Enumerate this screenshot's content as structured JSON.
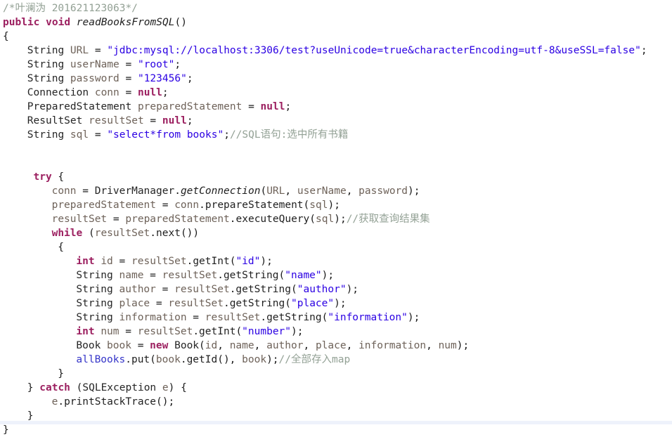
{
  "editor": {
    "language": "java",
    "background_color": "#ffffff",
    "font_size_px": 14.5,
    "line_height_px": 20,
    "theme_colors": {
      "keyword": "#9c2060",
      "string": "#2b00e3",
      "comment": "#93a195",
      "type": "#252525",
      "local_variable": "#6e6259",
      "field": "#3434c8",
      "method": "#1f1f1f",
      "punctuation": "#1a1a1a",
      "bottom_band": "#eef2fb"
    }
  },
  "code": {
    "header_comment": "/*叶澜沩 201621123063*/",
    "method_signature": {
      "modifier": "public",
      "return_type": "void",
      "name": "readBooksFromSQL()"
    },
    "literals": {
      "jdbc_url": "\"jdbc:mysql://localhost:3306/test?useUnicode=true&characterEncoding=utf-8&useSSL=false\"",
      "user_name": "\"root\"",
      "password": "\"123456\"",
      "sql": "\"select*from books\"",
      "col_id": "\"id\"",
      "col_name": "\"name\"",
      "col_author": "\"author\"",
      "col_place": "\"place\"",
      "col_information": "\"information\"",
      "col_number": "\"number\""
    },
    "comments": {
      "sql_statement": "//SQL语句:选中所有书籍",
      "result_set": "//获取查询结果集",
      "store_map": "//全部存入map"
    },
    "lines": [
      {
        "n": 1,
        "indent": 0,
        "tokens": [
          {
            "c": "t-cmt",
            "t": "/*叶澜沩 201621123063*/"
          }
        ]
      },
      {
        "n": 2,
        "indent": 0,
        "tokens": [
          {
            "c": "t-kw",
            "t": "public"
          },
          {
            "c": "t-plain",
            "t": " "
          },
          {
            "c": "t-kw",
            "t": "void"
          },
          {
            "c": "t-plain",
            "t": " "
          },
          {
            "c": "t-methodi",
            "t": "readBooksFromSQL"
          },
          {
            "c": "t-punct",
            "t": "()"
          }
        ]
      },
      {
        "n": 3,
        "indent": 0,
        "tokens": [
          {
            "c": "t-punct",
            "t": "{"
          }
        ]
      },
      {
        "n": 4,
        "indent": 4,
        "tokens": [
          {
            "c": "t-type",
            "t": "String"
          },
          {
            "c": "t-plain",
            "t": " "
          },
          {
            "c": "t-var",
            "t": "URL"
          },
          {
            "c": "t-plain",
            "t": " = "
          },
          {
            "c": "t-str",
            "t": "\"jdbc:mysql://localhost:3306/test?useUnicode=true&characterEncoding=utf-8&useSSL=false\""
          },
          {
            "c": "t-punct",
            "t": ";"
          }
        ]
      },
      {
        "n": 5,
        "indent": 4,
        "tokens": [
          {
            "c": "t-type",
            "t": "String"
          },
          {
            "c": "t-plain",
            "t": " "
          },
          {
            "c": "t-var",
            "t": "userName"
          },
          {
            "c": "t-plain",
            "t": " = "
          },
          {
            "c": "t-str",
            "t": "\"root\""
          },
          {
            "c": "t-punct",
            "t": ";"
          }
        ]
      },
      {
        "n": 6,
        "indent": 4,
        "tokens": [
          {
            "c": "t-type",
            "t": "String"
          },
          {
            "c": "t-plain",
            "t": " "
          },
          {
            "c": "t-var",
            "t": "password"
          },
          {
            "c": "t-plain",
            "t": " = "
          },
          {
            "c": "t-str",
            "t": "\"123456\""
          },
          {
            "c": "t-punct",
            "t": ";"
          }
        ]
      },
      {
        "n": 7,
        "indent": 4,
        "tokens": [
          {
            "c": "t-type",
            "t": "Connection"
          },
          {
            "c": "t-plain",
            "t": " "
          },
          {
            "c": "t-var",
            "t": "conn"
          },
          {
            "c": "t-plain",
            "t": " = "
          },
          {
            "c": "t-kw",
            "t": "null"
          },
          {
            "c": "t-punct",
            "t": ";"
          }
        ]
      },
      {
        "n": 8,
        "indent": 4,
        "tokens": [
          {
            "c": "t-type",
            "t": "PreparedStatement"
          },
          {
            "c": "t-plain",
            "t": " "
          },
          {
            "c": "t-var",
            "t": "preparedStatement"
          },
          {
            "c": "t-plain",
            "t": " = "
          },
          {
            "c": "t-kw",
            "t": "null"
          },
          {
            "c": "t-punct",
            "t": ";"
          }
        ]
      },
      {
        "n": 9,
        "indent": 4,
        "tokens": [
          {
            "c": "t-type",
            "t": "ResultSet"
          },
          {
            "c": "t-plain",
            "t": " "
          },
          {
            "c": "t-var",
            "t": "resultSet"
          },
          {
            "c": "t-plain",
            "t": " = "
          },
          {
            "c": "t-kw",
            "t": "null"
          },
          {
            "c": "t-punct",
            "t": ";"
          }
        ]
      },
      {
        "n": 10,
        "indent": 4,
        "tokens": [
          {
            "c": "t-type",
            "t": "String"
          },
          {
            "c": "t-plain",
            "t": " "
          },
          {
            "c": "t-var",
            "t": "sql"
          },
          {
            "c": "t-plain",
            "t": " = "
          },
          {
            "c": "t-str",
            "t": "\"select*from books\""
          },
          {
            "c": "t-punct",
            "t": ";"
          },
          {
            "c": "t-cmt",
            "t": "//SQL语句:选中所有书籍"
          }
        ]
      },
      {
        "n": 11,
        "indent": 0,
        "tokens": []
      },
      {
        "n": 12,
        "indent": 0,
        "tokens": []
      },
      {
        "n": 13,
        "indent": 5,
        "tokens": [
          {
            "c": "t-kw",
            "t": "try"
          },
          {
            "c": "t-punct",
            "t": " {"
          }
        ]
      },
      {
        "n": 14,
        "indent": 8,
        "tokens": [
          {
            "c": "t-var",
            "t": "conn"
          },
          {
            "c": "t-plain",
            "t": " = "
          },
          {
            "c": "t-type",
            "t": "DriverManager"
          },
          {
            "c": "t-punct",
            "t": "."
          },
          {
            "c": "t-methodi",
            "t": "getConnection"
          },
          {
            "c": "t-punct",
            "t": "("
          },
          {
            "c": "t-var",
            "t": "URL"
          },
          {
            "c": "t-punct",
            "t": ", "
          },
          {
            "c": "t-var",
            "t": "userName"
          },
          {
            "c": "t-punct",
            "t": ", "
          },
          {
            "c": "t-var",
            "t": "password"
          },
          {
            "c": "t-punct",
            "t": ");"
          }
        ]
      },
      {
        "n": 15,
        "indent": 8,
        "tokens": [
          {
            "c": "t-var",
            "t": "preparedStatement"
          },
          {
            "c": "t-plain",
            "t": " = "
          },
          {
            "c": "t-var",
            "t": "conn"
          },
          {
            "c": "t-punct",
            "t": "."
          },
          {
            "c": "t-method",
            "t": "prepareStatement"
          },
          {
            "c": "t-punct",
            "t": "("
          },
          {
            "c": "t-var",
            "t": "sql"
          },
          {
            "c": "t-punct",
            "t": ");"
          }
        ]
      },
      {
        "n": 16,
        "indent": 8,
        "tokens": [
          {
            "c": "t-var",
            "t": "resultSet"
          },
          {
            "c": "t-plain",
            "t": " = "
          },
          {
            "c": "t-var",
            "t": "preparedStatement"
          },
          {
            "c": "t-punct",
            "t": "."
          },
          {
            "c": "t-method",
            "t": "executeQuery"
          },
          {
            "c": "t-punct",
            "t": "("
          },
          {
            "c": "t-var",
            "t": "sql"
          },
          {
            "c": "t-punct",
            "t": ");"
          },
          {
            "c": "t-cmt",
            "t": "//获取查询结果集"
          }
        ]
      },
      {
        "n": 17,
        "indent": 8,
        "tokens": [
          {
            "c": "t-kw",
            "t": "while"
          },
          {
            "c": "t-punct",
            "t": " ("
          },
          {
            "c": "t-var",
            "t": "resultSet"
          },
          {
            "c": "t-punct",
            "t": "."
          },
          {
            "c": "t-method",
            "t": "next"
          },
          {
            "c": "t-punct",
            "t": "())"
          }
        ]
      },
      {
        "n": 18,
        "indent": 9,
        "tokens": [
          {
            "c": "t-punct",
            "t": "{"
          }
        ]
      },
      {
        "n": 19,
        "indent": 12,
        "tokens": [
          {
            "c": "t-kw",
            "t": "int"
          },
          {
            "c": "t-plain",
            "t": " "
          },
          {
            "c": "t-var",
            "t": "id"
          },
          {
            "c": "t-plain",
            "t": " = "
          },
          {
            "c": "t-var",
            "t": "resultSet"
          },
          {
            "c": "t-punct",
            "t": "."
          },
          {
            "c": "t-method",
            "t": "getInt"
          },
          {
            "c": "t-punct",
            "t": "("
          },
          {
            "c": "t-str",
            "t": "\"id\""
          },
          {
            "c": "t-punct",
            "t": ");"
          }
        ]
      },
      {
        "n": 20,
        "indent": 12,
        "tokens": [
          {
            "c": "t-type",
            "t": "String"
          },
          {
            "c": "t-plain",
            "t": " "
          },
          {
            "c": "t-var",
            "t": "name"
          },
          {
            "c": "t-plain",
            "t": " = "
          },
          {
            "c": "t-var",
            "t": "resultSet"
          },
          {
            "c": "t-punct",
            "t": "."
          },
          {
            "c": "t-method",
            "t": "getString"
          },
          {
            "c": "t-punct",
            "t": "("
          },
          {
            "c": "t-str",
            "t": "\"name\""
          },
          {
            "c": "t-punct",
            "t": ");"
          }
        ]
      },
      {
        "n": 21,
        "indent": 12,
        "tokens": [
          {
            "c": "t-type",
            "t": "String"
          },
          {
            "c": "t-plain",
            "t": " "
          },
          {
            "c": "t-var",
            "t": "author"
          },
          {
            "c": "t-plain",
            "t": " = "
          },
          {
            "c": "t-var",
            "t": "resultSet"
          },
          {
            "c": "t-punct",
            "t": "."
          },
          {
            "c": "t-method",
            "t": "getString"
          },
          {
            "c": "t-punct",
            "t": "("
          },
          {
            "c": "t-str",
            "t": "\"author\""
          },
          {
            "c": "t-punct",
            "t": ");"
          }
        ]
      },
      {
        "n": 22,
        "indent": 12,
        "tokens": [
          {
            "c": "t-type",
            "t": "String"
          },
          {
            "c": "t-plain",
            "t": " "
          },
          {
            "c": "t-var",
            "t": "place"
          },
          {
            "c": "t-plain",
            "t": " = "
          },
          {
            "c": "t-var",
            "t": "resultSet"
          },
          {
            "c": "t-punct",
            "t": "."
          },
          {
            "c": "t-method",
            "t": "getString"
          },
          {
            "c": "t-punct",
            "t": "("
          },
          {
            "c": "t-str",
            "t": "\"place\""
          },
          {
            "c": "t-punct",
            "t": ");"
          }
        ]
      },
      {
        "n": 23,
        "indent": 12,
        "tokens": [
          {
            "c": "t-type",
            "t": "String"
          },
          {
            "c": "t-plain",
            "t": " "
          },
          {
            "c": "t-var",
            "t": "information"
          },
          {
            "c": "t-plain",
            "t": " = "
          },
          {
            "c": "t-var",
            "t": "resultSet"
          },
          {
            "c": "t-punct",
            "t": "."
          },
          {
            "c": "t-method",
            "t": "getString"
          },
          {
            "c": "t-punct",
            "t": "("
          },
          {
            "c": "t-str",
            "t": "\"information\""
          },
          {
            "c": "t-punct",
            "t": ");"
          }
        ]
      },
      {
        "n": 24,
        "indent": 12,
        "tokens": [
          {
            "c": "t-kw",
            "t": "int"
          },
          {
            "c": "t-plain",
            "t": " "
          },
          {
            "c": "t-var",
            "t": "num"
          },
          {
            "c": "t-plain",
            "t": " = "
          },
          {
            "c": "t-var",
            "t": "resultSet"
          },
          {
            "c": "t-punct",
            "t": "."
          },
          {
            "c": "t-method",
            "t": "getInt"
          },
          {
            "c": "t-punct",
            "t": "("
          },
          {
            "c": "t-str",
            "t": "\"number\""
          },
          {
            "c": "t-punct",
            "t": ");"
          }
        ]
      },
      {
        "n": 25,
        "indent": 12,
        "tokens": [
          {
            "c": "t-type",
            "t": "Book"
          },
          {
            "c": "t-plain",
            "t": " "
          },
          {
            "c": "t-var",
            "t": "book"
          },
          {
            "c": "t-plain",
            "t": " = "
          },
          {
            "c": "t-kw",
            "t": "new"
          },
          {
            "c": "t-plain",
            "t": " "
          },
          {
            "c": "t-type",
            "t": "Book"
          },
          {
            "c": "t-punct",
            "t": "("
          },
          {
            "c": "t-var",
            "t": "id"
          },
          {
            "c": "t-punct",
            "t": ", "
          },
          {
            "c": "t-var",
            "t": "name"
          },
          {
            "c": "t-punct",
            "t": ", "
          },
          {
            "c": "t-var",
            "t": "author"
          },
          {
            "c": "t-punct",
            "t": ", "
          },
          {
            "c": "t-var",
            "t": "place"
          },
          {
            "c": "t-punct",
            "t": ", "
          },
          {
            "c": "t-var",
            "t": "information"
          },
          {
            "c": "t-punct",
            "t": ", "
          },
          {
            "c": "t-var",
            "t": "num"
          },
          {
            "c": "t-punct",
            "t": ");"
          }
        ]
      },
      {
        "n": 26,
        "indent": 12,
        "tokens": [
          {
            "c": "t-field",
            "t": "allBooks"
          },
          {
            "c": "t-punct",
            "t": "."
          },
          {
            "c": "t-method",
            "t": "put"
          },
          {
            "c": "t-punct",
            "t": "("
          },
          {
            "c": "t-var",
            "t": "book"
          },
          {
            "c": "t-punct",
            "t": "."
          },
          {
            "c": "t-method",
            "t": "getId"
          },
          {
            "c": "t-punct",
            "t": "(), "
          },
          {
            "c": "t-var",
            "t": "book"
          },
          {
            "c": "t-punct",
            "t": ");"
          },
          {
            "c": "t-cmt",
            "t": "//全部存入map"
          }
        ]
      },
      {
        "n": 27,
        "indent": 9,
        "tokens": [
          {
            "c": "t-punct",
            "t": "}"
          }
        ]
      },
      {
        "n": 28,
        "indent": 4,
        "tokens": [
          {
            "c": "t-punct",
            "t": "} "
          },
          {
            "c": "t-kw",
            "t": "catch"
          },
          {
            "c": "t-punct",
            "t": " ("
          },
          {
            "c": "t-type",
            "t": "SQLException"
          },
          {
            "c": "t-plain",
            "t": " "
          },
          {
            "c": "t-var",
            "t": "e"
          },
          {
            "c": "t-punct",
            "t": ") {"
          }
        ]
      },
      {
        "n": 29,
        "indent": 8,
        "tokens": [
          {
            "c": "t-var",
            "t": "e"
          },
          {
            "c": "t-punct",
            "t": "."
          },
          {
            "c": "t-method",
            "t": "printStackTrace"
          },
          {
            "c": "t-punct",
            "t": "();"
          }
        ]
      },
      {
        "n": 30,
        "indent": 4,
        "tokens": [
          {
            "c": "t-punct",
            "t": "}"
          }
        ]
      },
      {
        "n": 31,
        "indent": 0,
        "tokens": [
          {
            "c": "t-punct",
            "t": "}"
          }
        ]
      }
    ]
  }
}
